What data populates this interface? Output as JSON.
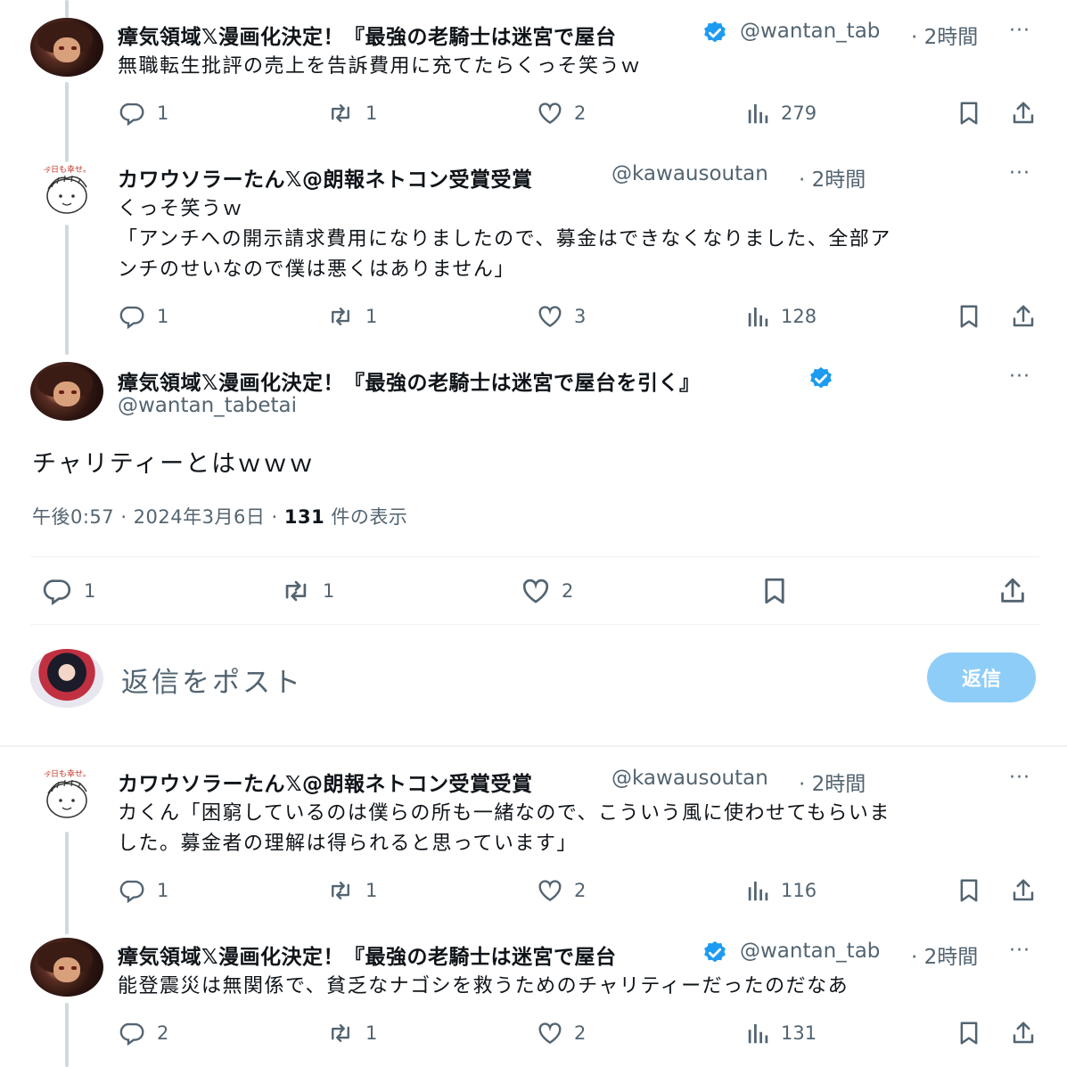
{
  "tweet1": {
    "name": "瘴気領域𝕏漫画化決定！『最強の老騎士は迷宮で屋台",
    "handle": "@wantan_tab",
    "time": "· 2時間",
    "text": "無職転生批評の売上を告訴費用に充てたらくっそ笑うｗ",
    "replies": "1",
    "retweets": "1",
    "likes": "2",
    "views": "279"
  },
  "tweet2": {
    "name": "カワウソラーたん𝕏@朗報ネトコン受賞受賞",
    "handle": "@kawausoutan",
    "time": "· 2時間",
    "text_lines": [
      "くっそ笑うｗ",
      "「アンチへの開示請求費用になりましたので、募金はできなくなりました、全部ア",
      "ンチのせいなので僕は悪くはありません」"
    ],
    "replies": "1",
    "retweets": "1",
    "likes": "3",
    "views": "128"
  },
  "main_tweet": {
    "name": "瘴気領域𝕏漫画化決定！『最強の老騎士は迷宮で屋台を引く』",
    "handle": "@wantan_tabetai",
    "text": "チャリティーとはｗｗｗ",
    "time": "午後0:57 · 2024年3月6日 · ",
    "view_count": "131",
    "view_label": " 件の表示",
    "replies": "1",
    "retweets": "1",
    "likes": "2"
  },
  "composer": {
    "placeholder": "返信をポスト",
    "button": "返信"
  },
  "tweet3": {
    "name": "カワウソラーたん𝕏@朗報ネトコン受賞受賞",
    "handle": "@kawausoutan",
    "time": "· 2時間",
    "text_lines": [
      "カくん「困窮しているのは僕らの所も一緒なので、こういう風に使わせてもらいま",
      "した。募金者の理解は得られると思っています」"
    ],
    "replies": "1",
    "retweets": "1",
    "likes": "2",
    "views": "116"
  },
  "tweet4": {
    "name": "瘴気領域𝕏漫画化決定！『最強の老騎士は迷宮で屋台",
    "handle": "@wantan_tab",
    "time": "· 2時間",
    "text": "能登震災は無関係で、貧乏なナゴシを救うためのチャリティーだったのだなあ",
    "replies": "2",
    "retweets": "1",
    "likes": "2",
    "views": "131"
  },
  "kawa_avatar_text": "今日も幸せ。",
  "more_glyph": "···",
  "colors": {
    "verified": "#1d9bf0",
    "muted": "#536471",
    "reply_button": "#8ecdf8"
  }
}
